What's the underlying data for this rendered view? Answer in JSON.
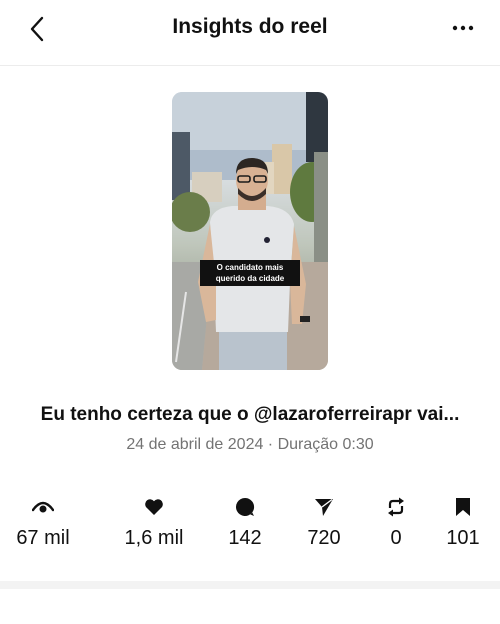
{
  "header": {
    "title": "Insights do reel",
    "back_icon": "chevron-left-icon",
    "more_icon": "more-horizontal-icon"
  },
  "reel": {
    "thumbnail_caption": "O candidato mais querido da cidade",
    "post_caption": "Eu tenho certeza que o @lazaroferreirapr vai...",
    "meta": "24 de abril de 2024 · Duração 0:30"
  },
  "stats": [
    {
      "icon": "eye-icon",
      "value": "67 mil"
    },
    {
      "icon": "heart-icon",
      "value": "1,6 mil"
    },
    {
      "icon": "comment-icon",
      "value": "142"
    },
    {
      "icon": "share-icon",
      "value": "720"
    },
    {
      "icon": "repost-icon",
      "value": "0"
    },
    {
      "icon": "bookmark-icon",
      "value": "101"
    }
  ]
}
